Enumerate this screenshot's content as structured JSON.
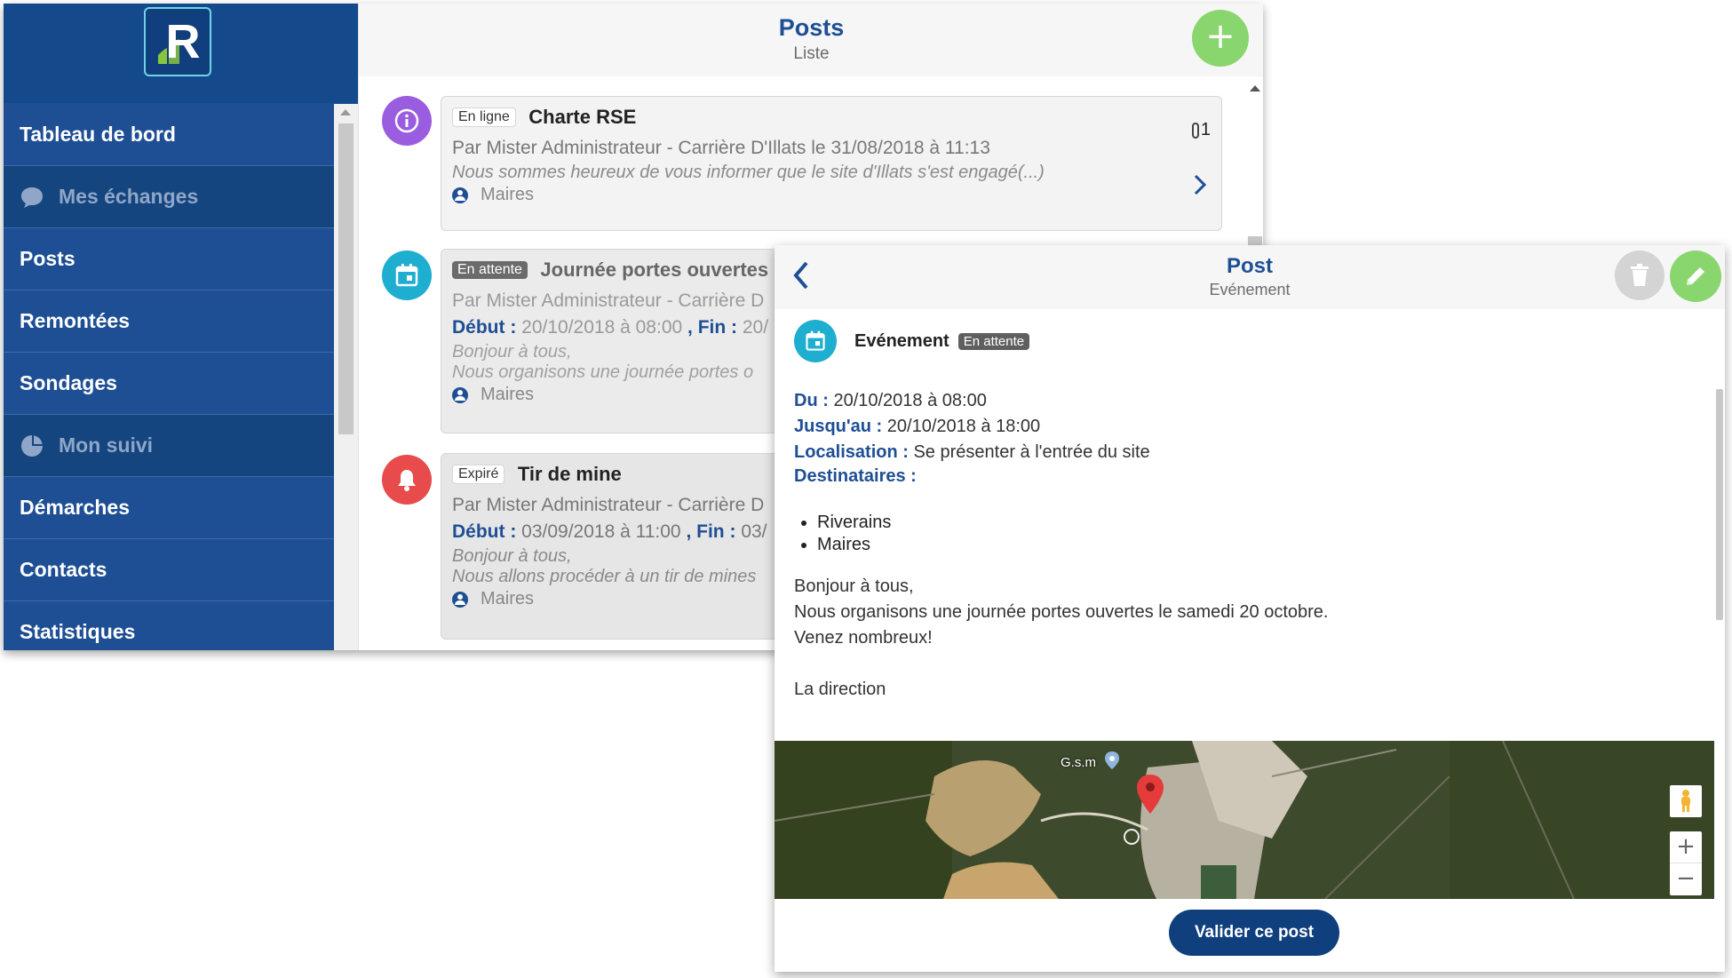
{
  "sidebar": {
    "logo_letter": "R",
    "items": [
      {
        "label": "Tableau de bord",
        "type": "link"
      },
      {
        "label": "Mes échanges",
        "type": "section"
      },
      {
        "label": "Posts",
        "type": "link"
      },
      {
        "label": "Remontées",
        "type": "link"
      },
      {
        "label": "Sondages",
        "type": "link"
      },
      {
        "label": "Mon suivi",
        "type": "section"
      },
      {
        "label": "Démarches",
        "type": "link"
      },
      {
        "label": "Contacts",
        "type": "link"
      },
      {
        "label": "Statistiques",
        "type": "link"
      }
    ]
  },
  "list": {
    "title": "Posts",
    "subtitle": "Liste",
    "add_label": "+",
    "posts": [
      {
        "status": "En ligne",
        "title": "Charte RSE",
        "meta": "Par Mister Administrateur - Carrière D'Illats le 31/08/2018 à 11:13",
        "excerpt": "Nous sommes heureux de vous informer que le site d'Illats s'est engagé(...)",
        "recipients": "Maires",
        "attachments": "1",
        "icon": "info-icon",
        "color": "#9b5de0"
      },
      {
        "status": "En attente",
        "title": "Journée portes ouvertes",
        "meta": "Par Mister Administrateur - Carrière D",
        "start_label": "Début :",
        "start": "20/10/2018 à 08:00",
        "end_label": ", Fin :",
        "end": "20/",
        "excerpt1": "Bonjour à tous,",
        "excerpt2": "Nous organisons une journée portes o",
        "recipients": "Maires",
        "icon": "calendar-icon",
        "color": "#1eaed0"
      },
      {
        "status": "Expiré",
        "title": "Tir de mine",
        "meta": "Par Mister Administrateur - Carrière D",
        "start_label": "Début :",
        "start": "03/09/2018 à 11:00",
        "end_label": ", Fin :",
        "end": "03/",
        "excerpt1": "Bonjour à tous,",
        "excerpt2": "Nous allons procéder à un tir de mines",
        "recipients": "Maires",
        "icon": "bell-icon",
        "color": "#e84b4b"
      }
    ]
  },
  "detail": {
    "title": "Post",
    "subtitle": "Evénement",
    "type_label": "Evénement",
    "status": "En attente",
    "from_label": "Du :",
    "from": "20/10/2018 à 08:00",
    "until_label": "Jusqu'au :",
    "until": "20/10/2018 à 18:00",
    "location_label": "Localisation :",
    "location": "Se présenter à l'entrée du site",
    "recipients_label": "Destinataires :",
    "recipients": [
      "Riverains",
      "Maires"
    ],
    "body": [
      "Bonjour à tous,",
      "Nous organisons une journée portes ouvertes le samedi 20 octobre.",
      "Venez nombreux!",
      "",
      "La direction"
    ],
    "map_place": "G.s.m",
    "zoom_in": "+",
    "zoom_out": "−",
    "validate_label": "Valider ce post"
  },
  "colors": {
    "sidebar": "#1e4f94",
    "accent_green": "#8ad66e",
    "primary_blue": "#1e4f94",
    "validate_blue": "#0f3f7d"
  }
}
